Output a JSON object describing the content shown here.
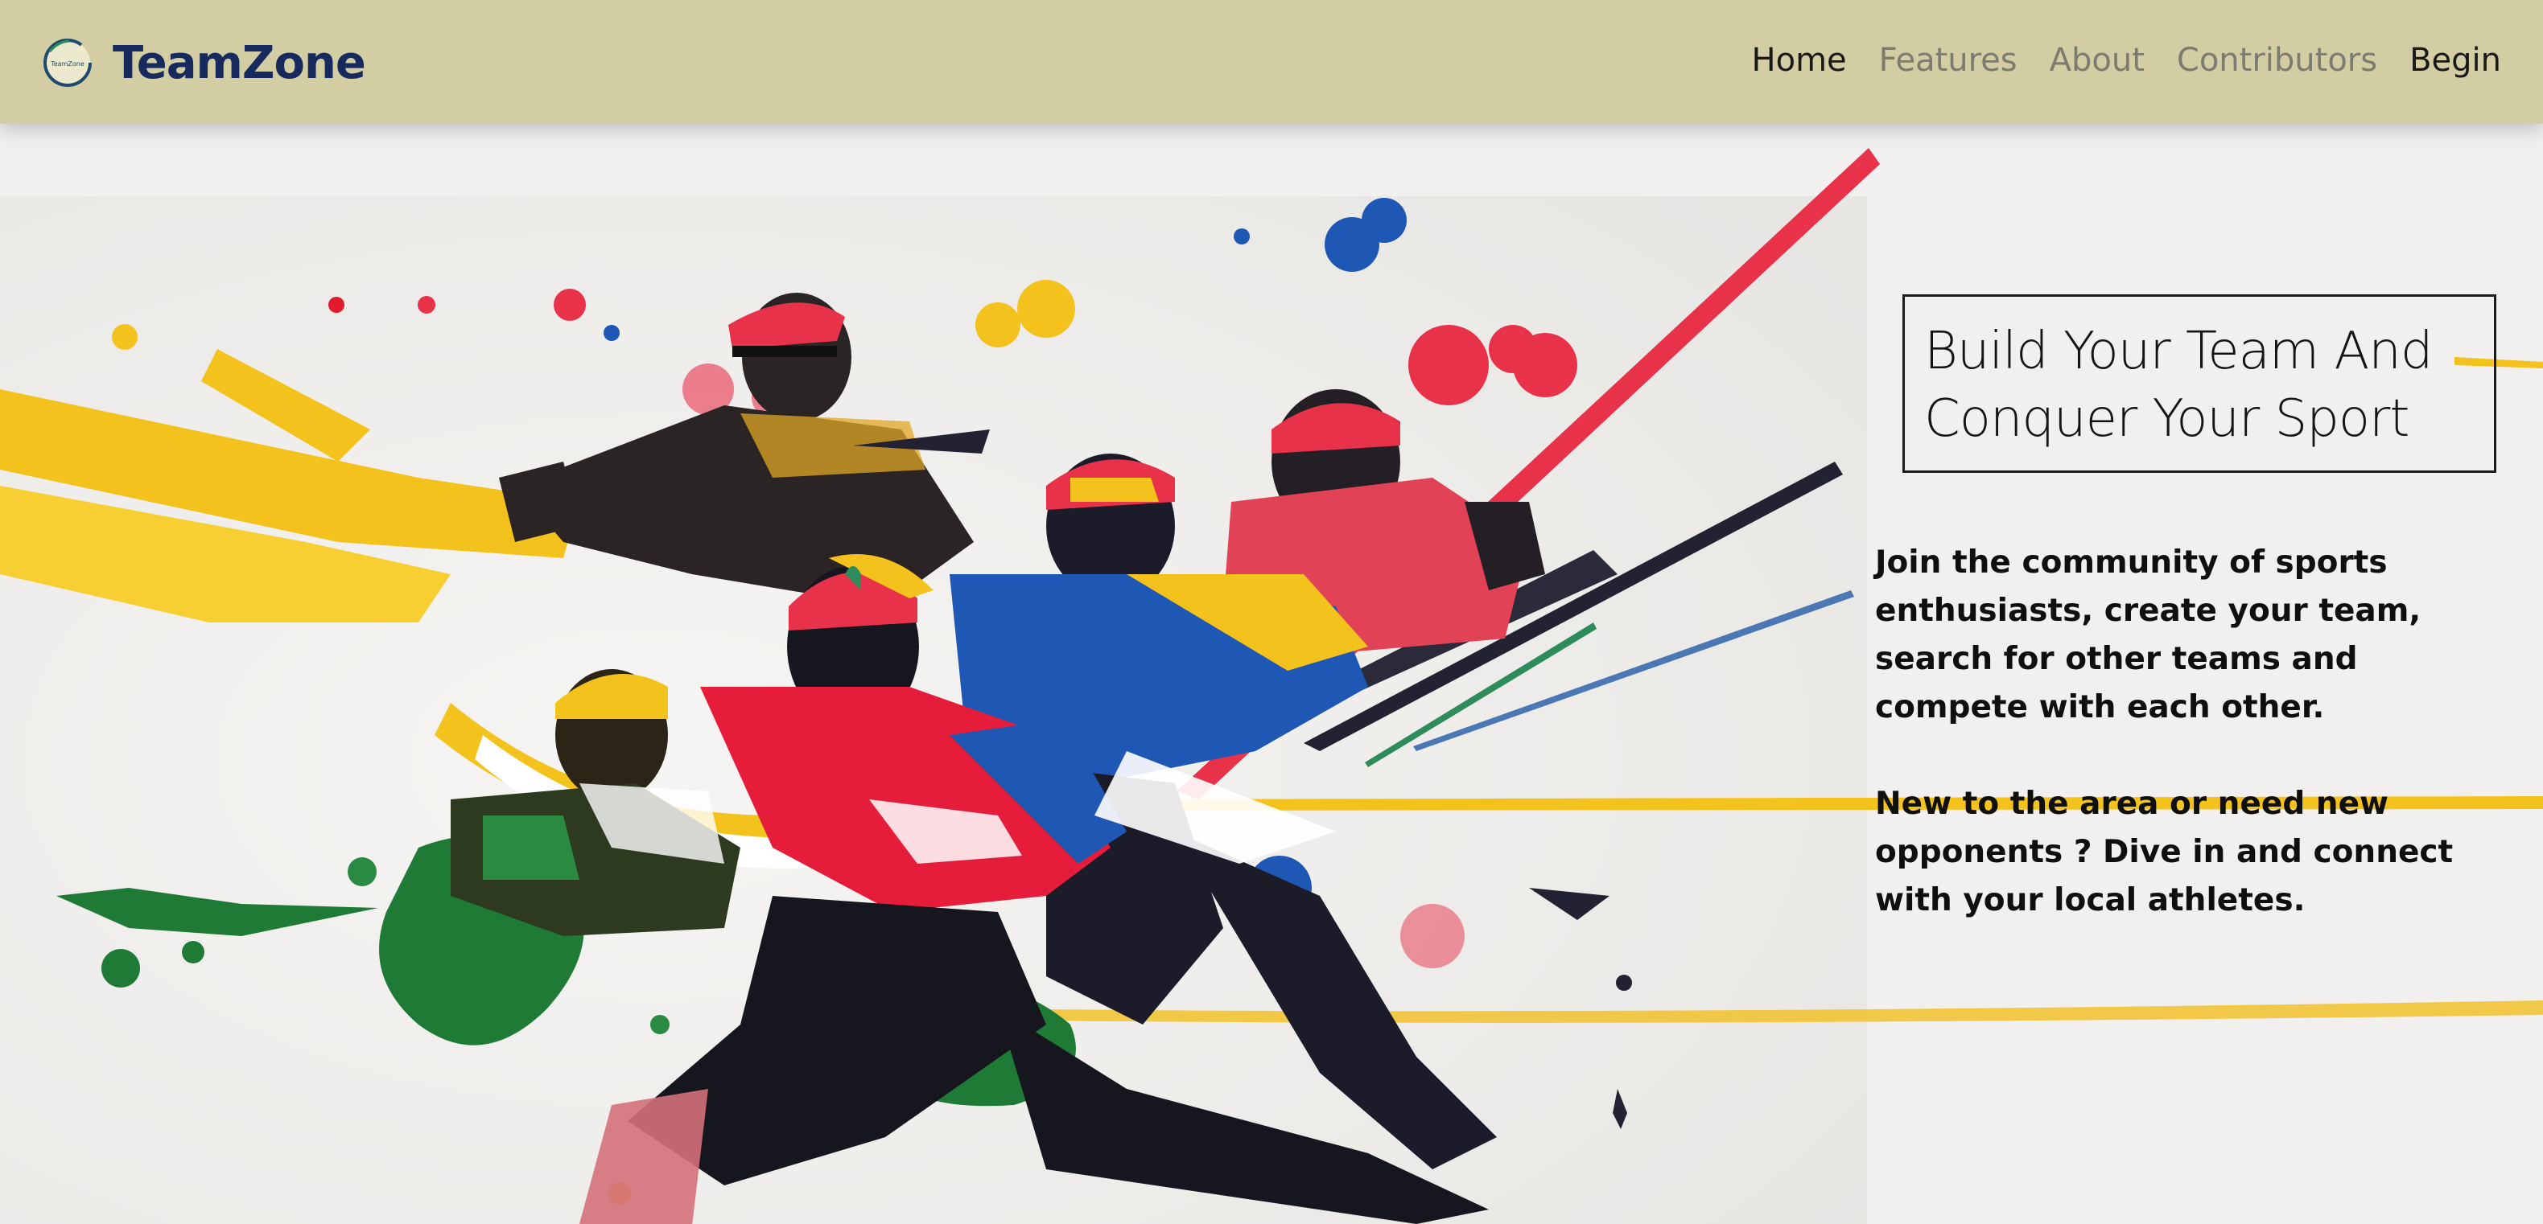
{
  "brand": {
    "name": "TeamZone",
    "logo_text": "TeamZone",
    "logo_icon": "teamzone-logo-icon"
  },
  "nav": {
    "items": [
      {
        "label": "Home",
        "active": true
      },
      {
        "label": "Features",
        "active": false
      },
      {
        "label": "About",
        "active": false
      },
      {
        "label": "Contributors",
        "active": false
      },
      {
        "label": "Begin",
        "active": false
      }
    ]
  },
  "hero": {
    "title_line1": "Build Your Team And",
    "title_line2": "Conquer Your Sport",
    "paragraph1": "Join the community of sports enthusiasts, create your team, search for other teams and compete with each other.",
    "paragraph2": "New to the area or need new opponents ? Dive in and connect with your local athletes.",
    "image": "sports-athletes-paint-splash-illustration"
  },
  "colors": {
    "navbar_bg": "#d2cda2",
    "brand_text": "#172a5e",
    "nav_active": "#191919",
    "nav_inactive": "#7c7b70",
    "page_bg": "#f1f0ee",
    "accent_yellow": "#f4c21c",
    "accent_red": "#e8324a",
    "accent_blue": "#1f57b5",
    "accent_green": "#1f7a36"
  }
}
